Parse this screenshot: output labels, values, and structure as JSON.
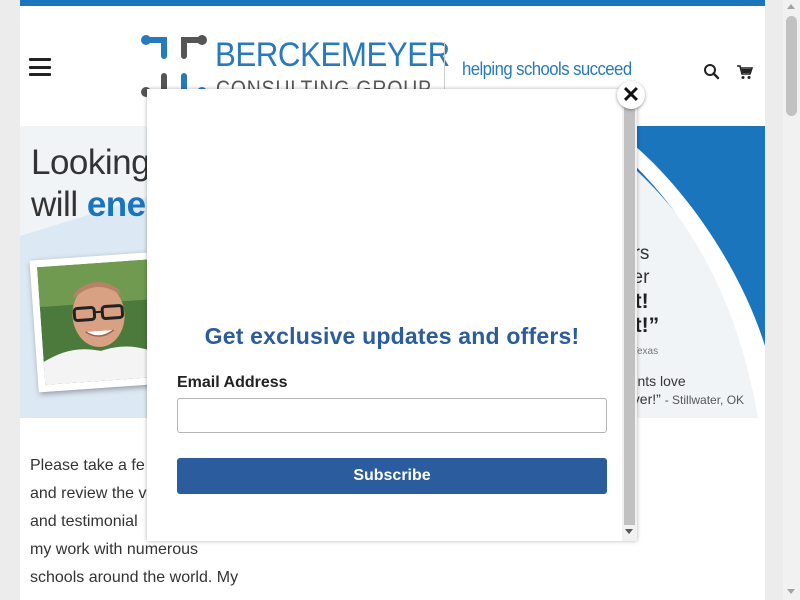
{
  "header": {
    "logo_line1": "BERCKEMEYER",
    "logo_line2": "CONSULTING GROUP",
    "tagline": "helping schools succeed",
    "menu_icon": "hamburger-menu-icon",
    "search_icon": "search-icon",
    "cart_icon": "cart-icon"
  },
  "hero": {
    "headline_line1": "Looking",
    "headline_line2_prefix": "will ",
    "headline_line2_strong": "ene",
    "quote_line1": "ars",
    "quote_line2": "ker",
    "quote_line3": "at!",
    "quote_line4": "at!”",
    "quote_attr": "Texas",
    "quote2_line1": "rents love",
    "quote2_line2": "ever!”",
    "quote2_attr": "- Stillwater, OK"
  },
  "body": {
    "line1": "Please take a fe",
    "line2": "and review the v",
    "line3": "and testimonial",
    "line4": "my work with numerous",
    "line5": "schools around the world. My"
  },
  "modal": {
    "close_label": "✕",
    "title": "Get exclusive updates and offers!",
    "email_label": "Email Address",
    "email_value": "",
    "email_placeholder": "",
    "subscribe_label": "Subscribe"
  },
  "colors": {
    "brand_blue": "#1a75bc",
    "button_blue": "#2b5c9e",
    "logo_gray": "#555555"
  }
}
